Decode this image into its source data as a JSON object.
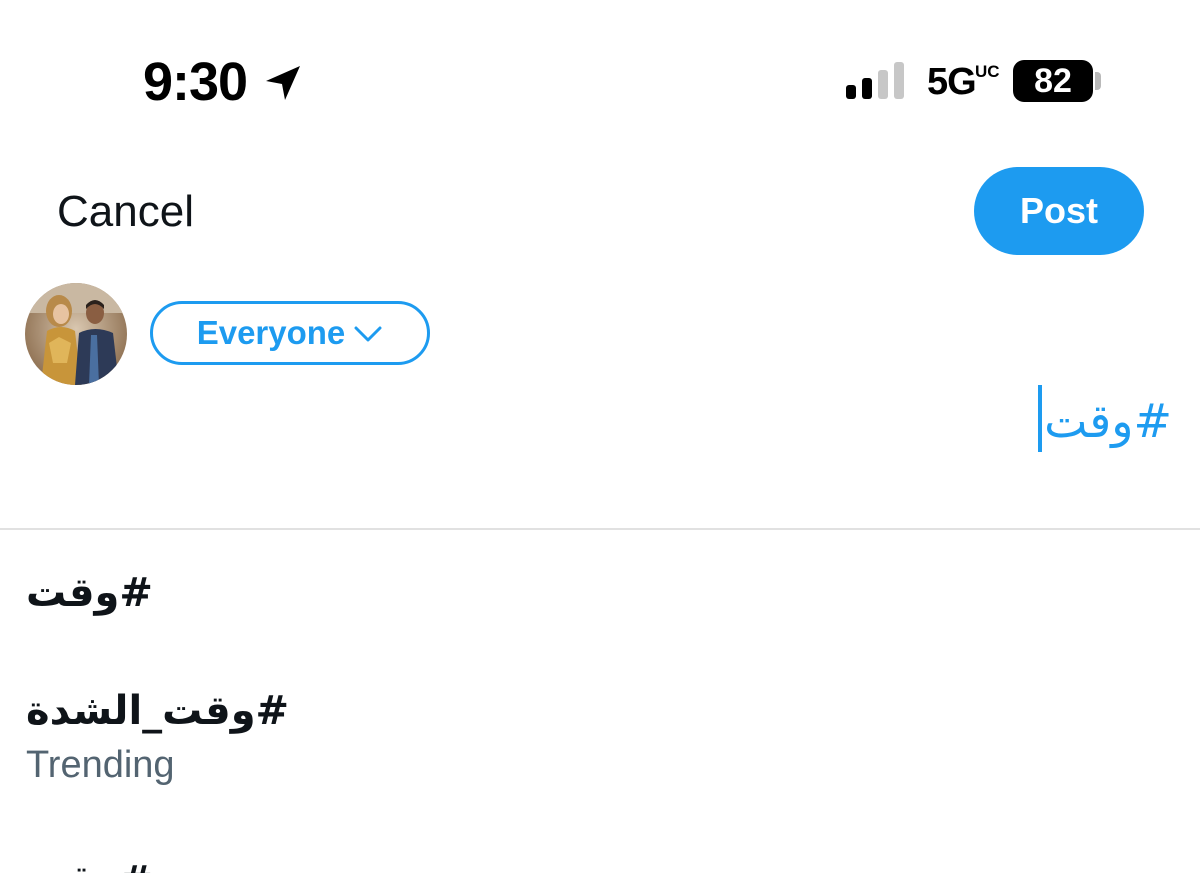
{
  "status_bar": {
    "time": "9:30",
    "network": "5G",
    "network_superscript": "UC",
    "battery": "82",
    "icons": [
      "location-arrow-icon",
      "signal-strength-icon"
    ]
  },
  "header": {
    "cancel_label": "Cancel",
    "post_label": "Post"
  },
  "composer": {
    "audience_label": "Everyone",
    "text": "#وقت",
    "avatar_icon": "user-avatar"
  },
  "suggestions": [
    {
      "tag": "#وقت",
      "subtitle": ""
    },
    {
      "tag": "#وقت_الشدة",
      "subtitle": "Trending"
    },
    {
      "tag": "#وقت",
      "subtitle": ""
    }
  ],
  "colors": {
    "accent": "#1d9bf0",
    "text": "#0f1419",
    "secondary_text": "#536471",
    "divider": "#e1e1e1"
  }
}
